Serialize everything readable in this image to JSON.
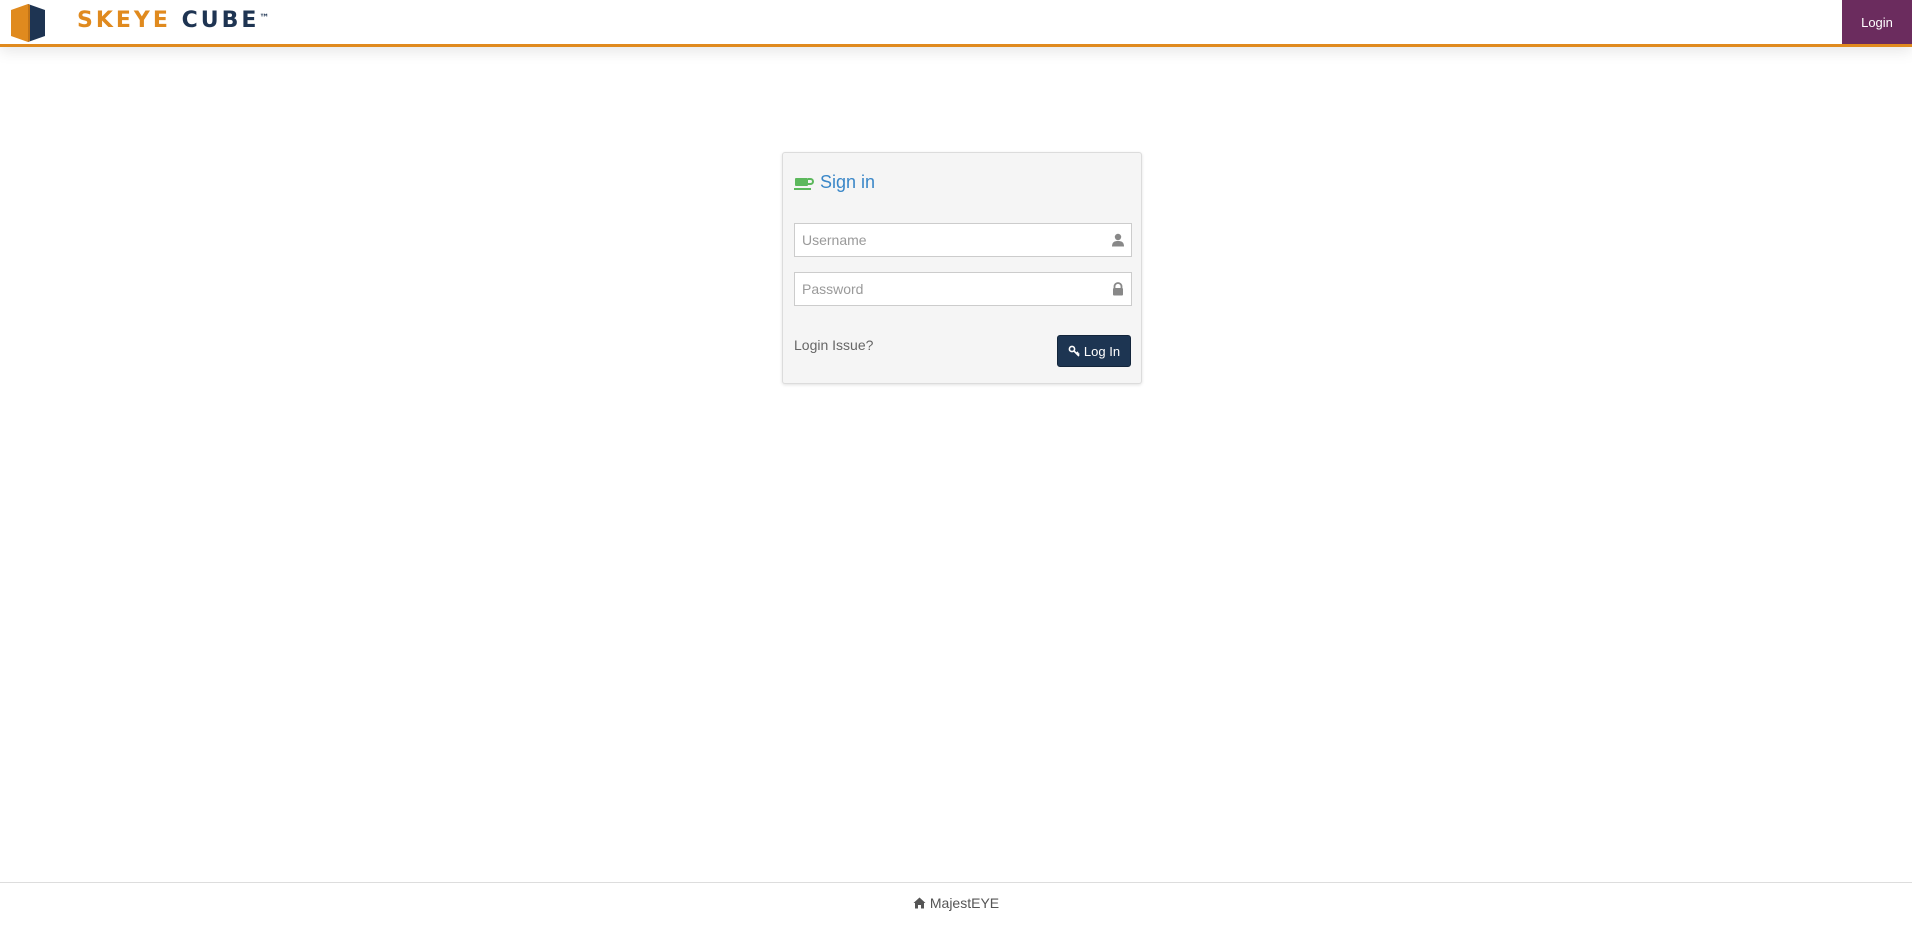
{
  "header": {
    "brand_part1": "SKEYE",
    "brand_part2": "CUBE",
    "brand_tm": "™",
    "login_label": "Login"
  },
  "signin": {
    "title": "Sign in",
    "title_icon": "coffee-cup-icon",
    "username_placeholder": "Username",
    "username_icon": "user-icon",
    "password_placeholder": "Password",
    "password_icon": "lock-icon",
    "login_issue_label": "Login Issue?",
    "login_button_label": "Log In",
    "login_button_icon": "key-icon"
  },
  "footer": {
    "link_label": "MajestEYE",
    "link_icon": "home-icon"
  },
  "colors": {
    "accent_orange": "#e08a1e",
    "navy": "#1d3552",
    "nav_purple": "#6b2c5e",
    "title_blue": "#3a87c8",
    "cup_green": "#5cb85c"
  }
}
